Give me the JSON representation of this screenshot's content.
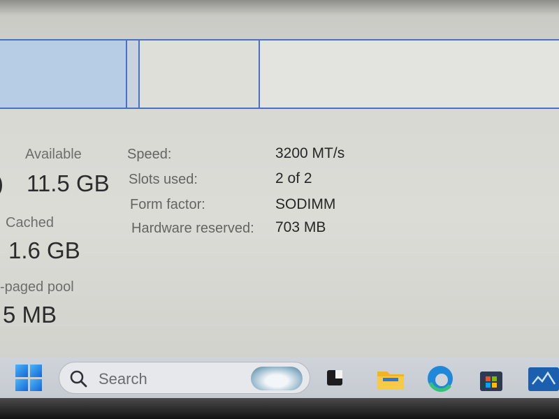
{
  "memory": {
    "available": {
      "label": "Available",
      "value": "11.5 GB"
    },
    "cached": {
      "label": "Cached",
      "value": "1.6 GB"
    },
    "non_paged_pool": {
      "label": "-paged pool",
      "value": "5 MB"
    },
    "left_edge_fragment": ")"
  },
  "specs": [
    {
      "key": "Speed:",
      "value": "3200 MT/s"
    },
    {
      "key": "Slots used:",
      "value": "2 of 2"
    },
    {
      "key": "Form factor:",
      "value": "SODIMM"
    },
    {
      "key": "Hardware reserved:",
      "value": "703 MB"
    }
  ],
  "taskbar": {
    "search_placeholder": "Search",
    "icons": [
      "start-icon",
      "search-icon",
      "task-view-icon",
      "file-explorer-icon",
      "edge-icon",
      "store-icon",
      "app-icon"
    ]
  },
  "colors": {
    "accent": "#4a6fc4",
    "in_use_fill": "#b7cde6",
    "taskbar": "#cfd3da"
  }
}
